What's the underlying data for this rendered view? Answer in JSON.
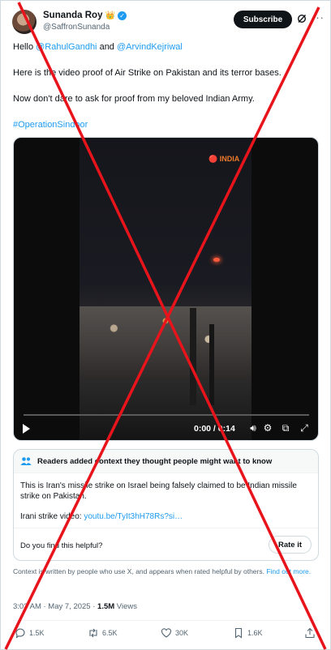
{
  "author": {
    "display_name": "Sunanda Roy",
    "crown_emoji": "👑",
    "handle": "@SaffronSunanda"
  },
  "header": {
    "subscribe_label": "Subscribe",
    "grok_icon": "grok-icon",
    "more_icon": "more-icon"
  },
  "tweet": {
    "line1_prefix": "Hello ",
    "mention1": "@RahulGandhi",
    "line1_mid": " and ",
    "mention2": "@ArvindKejriwal",
    "line2": "Here is the video proof of Air Strike on Pakistan and its terror bases.",
    "line3": "Now don't dare to ask for proof from my beloved Indian Army.",
    "hashtag": "#OperationSindoor"
  },
  "video": {
    "logo_text": "🔴 INDIA",
    "time": "0:00 / 0:14",
    "progress_fraction": 0.0
  },
  "community_note": {
    "title": "Readers added context they thought people might want to know",
    "body": "This is Iran's missile strike on Israel being falsely claimed to be Indian missile strike on Pakistan.",
    "source_label": "Irani strike video: ",
    "source_link": "youtu.be/TyIt3hH78Rs?si…",
    "helpful_question": "Do you find this helpful?",
    "rate_label": "Rate it"
  },
  "context_footer": {
    "text": "Context is written by people who use X, and appears when rated helpful by others. ",
    "link": "Find out more."
  },
  "meta": {
    "time": "3:03 AM · May 7, 2025 · ",
    "views_count": "1.5M",
    "views_label": " Views"
  },
  "actions": {
    "replies": "1.5K",
    "reposts": "6.5K",
    "likes": "30K",
    "bookmarks": "1.6K"
  },
  "colors": {
    "link": "#1d9bf0",
    "overlay_cross": "#e8141b"
  }
}
